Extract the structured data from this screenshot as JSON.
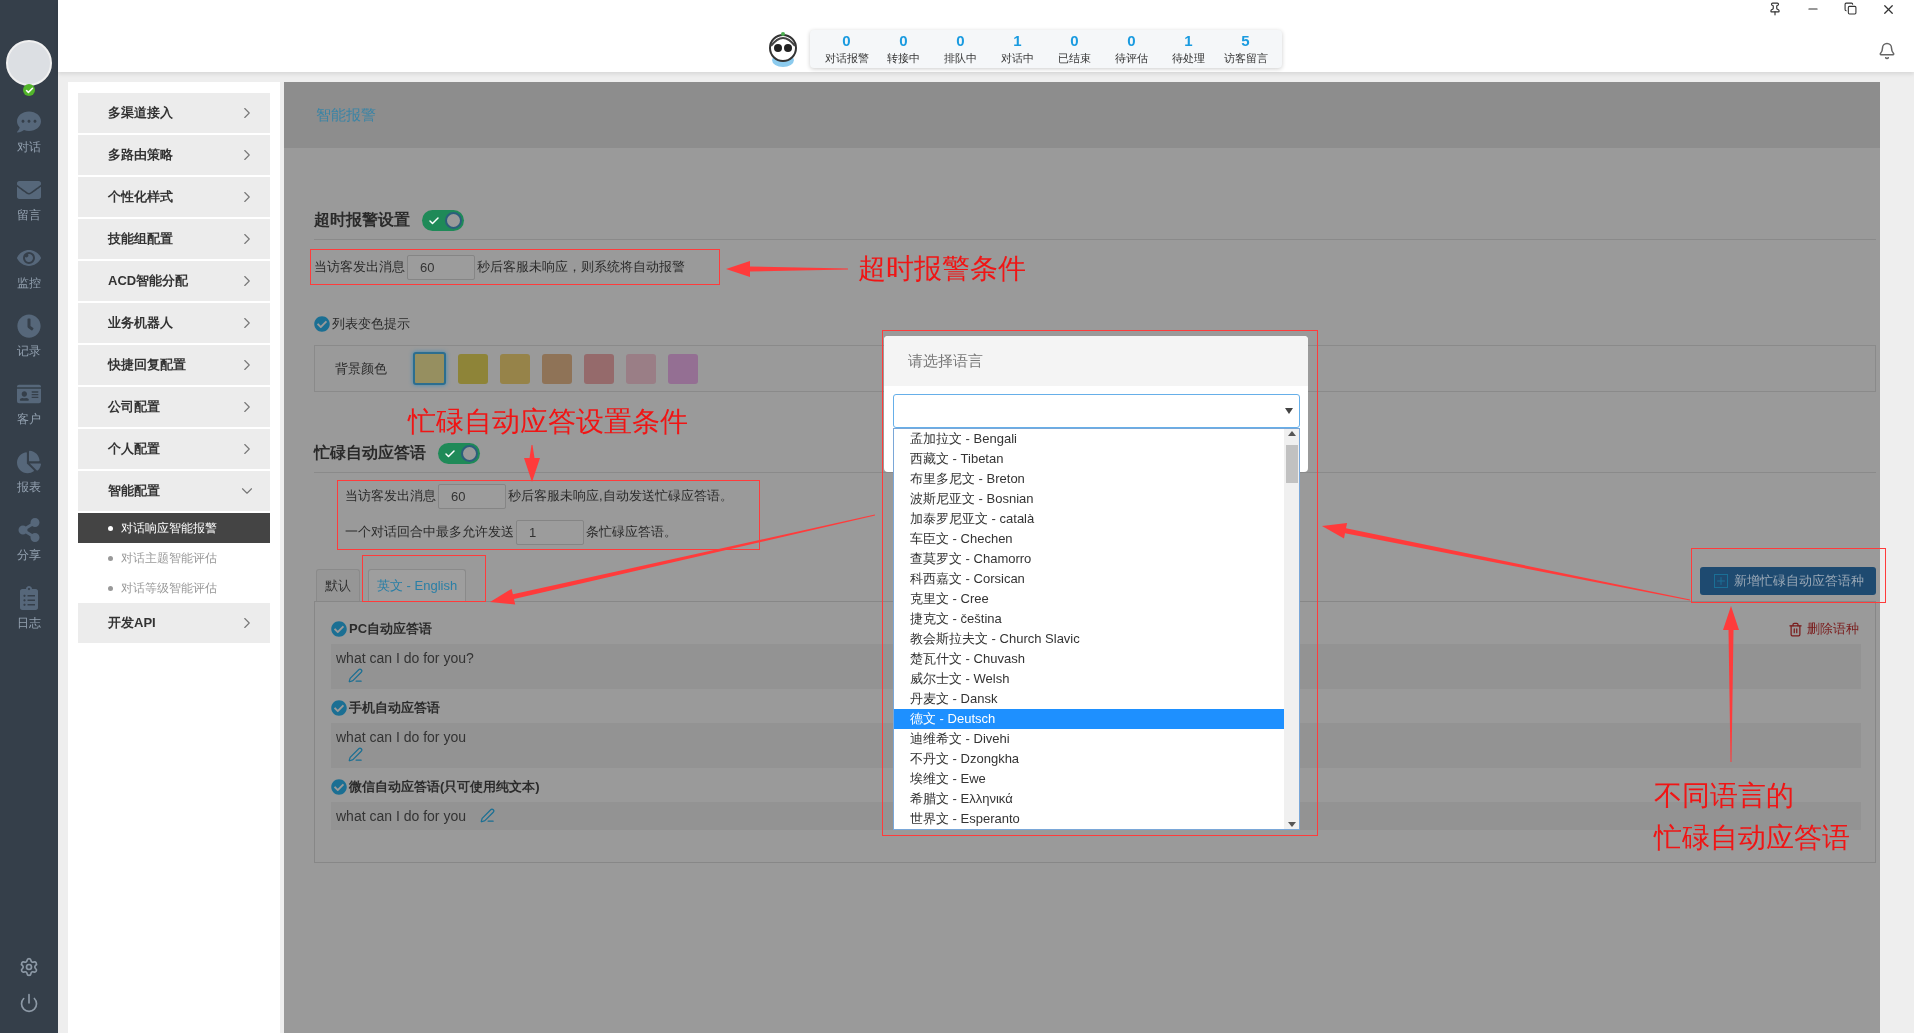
{
  "rail": {
    "items": [
      {
        "label": "对话"
      },
      {
        "label": "留言"
      },
      {
        "label": "监控"
      },
      {
        "label": "记录"
      },
      {
        "label": "客户"
      },
      {
        "label": "报表"
      },
      {
        "label": "分享"
      },
      {
        "label": "日志"
      }
    ]
  },
  "stats": [
    {
      "count": "0",
      "label": "对话报警"
    },
    {
      "count": "0",
      "label": "转接中"
    },
    {
      "count": "0",
      "label": "排队中"
    },
    {
      "count": "1",
      "label": "对话中"
    },
    {
      "count": "0",
      "label": "已结束"
    },
    {
      "count": "0",
      "label": "待评估"
    },
    {
      "count": "1",
      "label": "待处理"
    },
    {
      "count": "5",
      "label": "访客留言"
    }
  ],
  "menu": [
    {
      "label": "多渠道接入",
      "expanded": false
    },
    {
      "label": "多路由策略",
      "expanded": false
    },
    {
      "label": "个性化样式",
      "expanded": false
    },
    {
      "label": "技能组配置",
      "expanded": false
    },
    {
      "label": "ACD智能分配",
      "expanded": false
    },
    {
      "label": "业务机器人",
      "expanded": false
    },
    {
      "label": "快捷回复配置",
      "expanded": false
    },
    {
      "label": "公司配置",
      "expanded": false
    },
    {
      "label": "个人配置",
      "expanded": false
    },
    {
      "label": "智能配置",
      "expanded": true,
      "children": [
        {
          "label": "对话响应智能报警",
          "selected": true
        },
        {
          "label": "对话主题智能评估",
          "selected": false
        },
        {
          "label": "对话等级智能评估",
          "selected": false
        }
      ]
    },
    {
      "label": "开发API",
      "expanded": false
    }
  ],
  "page_title": "智能报警",
  "timeout": {
    "title": "超时报警设置",
    "on": true,
    "prefix": "当访客发出消息",
    "value": "60",
    "suffix": "秒后客服未响应，则系统将自动报警"
  },
  "color_hint": {
    "label": "列表变色提示",
    "checked": true,
    "bg_label": "背景颜色",
    "swatches": [
      {
        "color": "#968f60",
        "selected": true
      },
      {
        "color": "#8e8438",
        "selected": false
      },
      {
        "color": "#968349",
        "selected": false
      },
      {
        "color": "#8f7357",
        "selected": false
      },
      {
        "color": "#956a6b",
        "selected": false
      },
      {
        "color": "#9a7e86",
        "selected": false
      },
      {
        "color": "#946f93",
        "selected": false
      }
    ]
  },
  "busy": {
    "title": "忙碌自动应答语",
    "on": true,
    "rows": [
      {
        "prefix": "当访客发出消息",
        "value": "60",
        "suffix": "秒后客服未响应,自动发送忙碌应答语。"
      },
      {
        "prefix": "一个对话回合中最多允许发送",
        "value": "1",
        "suffix": "条忙碌应答语。"
      }
    ],
    "tabs": [
      {
        "label": "默认",
        "selected": false
      },
      {
        "label": "英文 - English",
        "selected": true
      }
    ],
    "add_button": "新增忙碌自动应答语种",
    "delete_link": "删除语种",
    "replies": [
      {
        "label": "PC自动应答语",
        "checked": true,
        "text": "what can I do for you?",
        "kind": "multiline"
      },
      {
        "label": "手机自动应答语",
        "checked": true,
        "text": "what can I do for you",
        "kind": "multiline"
      },
      {
        "label": "微信自动应答语(只可使用纯文本)",
        "checked": true,
        "text": "what can I do for you",
        "kind": "inline"
      }
    ]
  },
  "language_dialog": {
    "title": "请选择语言",
    "options": [
      {
        "label": "孟加拉文 - Bengali",
        "selected": false
      },
      {
        "label": "西藏文 - Tibetan",
        "selected": false
      },
      {
        "label": "布里多尼文 - Breton",
        "selected": false
      },
      {
        "label": "波斯尼亚文 - Bosnian",
        "selected": false
      },
      {
        "label": "加泰罗尼亚文 - català",
        "selected": false
      },
      {
        "label": "车臣文 - Chechen",
        "selected": false
      },
      {
        "label": "查莫罗文 - Chamorro",
        "selected": false
      },
      {
        "label": "科西嘉文 - Corsican",
        "selected": false
      },
      {
        "label": "克里文 - Cree",
        "selected": false
      },
      {
        "label": "捷克文 - čeština",
        "selected": false
      },
      {
        "label": "教会斯拉夫文 - Church Slavic",
        "selected": false
      },
      {
        "label": "楚瓦什文 - Chuvash",
        "selected": false
      },
      {
        "label": "威尔士文 - Welsh",
        "selected": false
      },
      {
        "label": "丹麦文 - Dansk",
        "selected": false
      },
      {
        "label": "德文 - Deutsch",
        "selected": true
      },
      {
        "label": "迪维希文 - Divehi",
        "selected": false
      },
      {
        "label": "不丹文 - Dzongkha",
        "selected": false
      },
      {
        "label": "埃维文 - Ewe",
        "selected": false
      },
      {
        "label": "希腊文 - Ελληνικά",
        "selected": false
      },
      {
        "label": "世界文 - Esperanto",
        "selected": false
      }
    ]
  },
  "annotations": {
    "timeout_note": "超时报警条件",
    "busy_note": "忙碌自动应答设置条件",
    "language_note": [
      "不同语言的",
      "忙碌自动应答语"
    ]
  }
}
